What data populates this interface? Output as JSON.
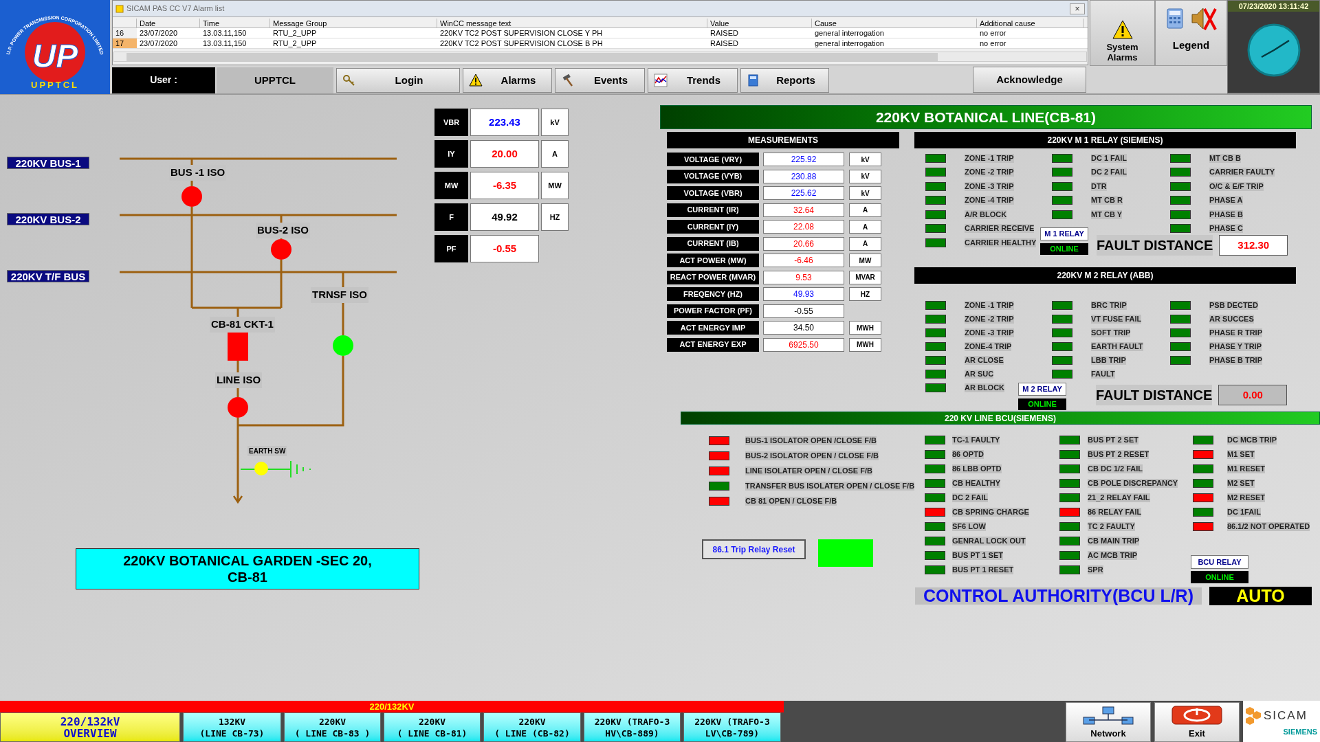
{
  "logo": {
    "arc_text": "U.P. POWER TRANSMISSION CORPORATION LIMITED",
    "mark": "UP",
    "name": "UPPTCL"
  },
  "alarm_window": {
    "title": "SICAM PAS CC V7 Alarm list",
    "close": "×",
    "columns": [
      "",
      "Date",
      "Time",
      "Message Group",
      "WinCC message text",
      "Value",
      "Cause",
      "Additional cause"
    ],
    "rows": [
      {
        "selected": false,
        "cells": [
          "16",
          "23/07/2020",
          "13.03.11,150",
          "RTU_2_UPP",
          "220KV TC2 POST SUPERVISION CLOSE Y PH",
          "RAISED",
          "general interrogation",
          "no error"
        ]
      },
      {
        "selected": true,
        "cells": [
          "17",
          "23/07/2020",
          "13.03.11,150",
          "RTU_2_UPP",
          "220KV TC2 POST SUPERVISION CLOSE B PH",
          "RAISED",
          "general interrogation",
          "no error"
        ]
      }
    ]
  },
  "toolbar": {
    "user_label": "User :",
    "user": "UPPTCL",
    "buttons": [
      {
        "label": "Login"
      },
      {
        "label": "Alarms"
      },
      {
        "label": "Events"
      },
      {
        "label": "Trends"
      },
      {
        "label": "Reports"
      }
    ],
    "acknowledge": "Acknowledge"
  },
  "side_panel": {
    "system_alarms": "System Alarms",
    "legend": "Legend",
    "clock_date": "07/23/2020 13:11:42"
  },
  "diagram": {
    "bus_labels": [
      "220KV BUS-1",
      "220KV BUS-2",
      "220KV T/F BUS"
    ],
    "elements": [
      {
        "kind": "isolator",
        "label": "BUS -1 ISO",
        "color": "#ff0000"
      },
      {
        "kind": "isolator",
        "label": "BUS-2 ISO",
        "color": "#ff0000"
      },
      {
        "kind": "isolator",
        "label": "TRNSF ISO",
        "color": "#00ff00"
      },
      {
        "kind": "breaker",
        "label": "CB-81 CKT-1",
        "color": "#ff0000"
      },
      {
        "kind": "isolator",
        "label": "LINE ISO",
        "color": "#ff0000"
      },
      {
        "kind": "earth_switch",
        "label": "EARTH SW",
        "color": "#ffff00"
      }
    ],
    "location": [
      "220KV BOTANICAL GARDEN -SEC 20,",
      "CB-81"
    ]
  },
  "quick_values": [
    {
      "label": "VBR",
      "value": "223.43",
      "unit": "kV",
      "color": "#0000ff"
    },
    {
      "label": "IY",
      "value": "20.00",
      "unit": "A",
      "color": "#ff0000"
    },
    {
      "label": "MW",
      "value": "-6.35",
      "unit": "MW",
      "color": "#ff0000"
    },
    {
      "label": "F",
      "value": "49.92",
      "unit": "HZ",
      "color": "#000000"
    },
    {
      "label": "PF",
      "value": "-0.55",
      "color": "#ff0000"
    }
  ],
  "line_title": "220KV BOTANICAL LINE(CB-81)",
  "measurements": {
    "title": "MEASUREMENTS",
    "rows": [
      {
        "label": "VOLTAGE (VRY)",
        "value": "225.92",
        "unit": "kV",
        "color": "#0000ff"
      },
      {
        "label": "VOLTAGE (VYB)",
        "value": "230.88",
        "unit": "kV",
        "color": "#0000ff"
      },
      {
        "label": "VOLTAGE (VBR)",
        "value": "225.62",
        "unit": "kV",
        "color": "#0000ff"
      },
      {
        "label": "CURRENT (IR)",
        "value": "32.64",
        "unit": "A",
        "color": "#ff0000"
      },
      {
        "label": "CURRENT (IY)",
        "value": "22.08",
        "unit": "A",
        "color": "#ff0000"
      },
      {
        "label": "CURRENT (IB)",
        "value": "20.66",
        "unit": "A",
        "color": "#ff0000"
      },
      {
        "label": "ACT POWER (MW)",
        "value": "-6.46",
        "unit": "MW",
        "color": "#ff0000"
      },
      {
        "label": "REACT POWER (MVAR)",
        "value": "9.53",
        "unit": "MVAR",
        "color": "#ff0000"
      },
      {
        "label": "FREQENCY (HZ)",
        "value": "49.93",
        "unit": "HZ",
        "color": "#0000ff"
      },
      {
        "label": "POWER FACTOR (PF)",
        "value": "-0.55",
        "color": "#000000"
      },
      {
        "label": "ACT ENERGY IMP",
        "value": "34.50",
        "unit": "MWH",
        "color": "#000000"
      },
      {
        "label": "ACT ENERGY EXP",
        "value": "6925.50",
        "unit": "MWH",
        "color": "#ff0000"
      }
    ]
  },
  "m1_relay": {
    "title": "220KV M 1 RELAY (SIEMENS)",
    "columns": [
      [
        {
          "label": "ZONE -1 TRIP",
          "color": "#008000"
        },
        {
          "label": "ZONE -2 TRIP",
          "color": "#008000"
        },
        {
          "label": "ZONE -3 TRIP",
          "color": "#008000"
        },
        {
          "label": "ZONE -4 TRIP",
          "color": "#008000"
        },
        {
          "label": "A/R BLOCK",
          "color": "#008000"
        },
        {
          "label": "CARRIER RECEIVE",
          "color": "#008000"
        },
        {
          "label": "CARRIER HEALTHY",
          "color": "#008000"
        }
      ],
      [
        {
          "label": "DC 1 FAIL",
          "color": "#008000"
        },
        {
          "label": "DC 2 FAIL",
          "color": "#008000"
        },
        {
          "label": "DTR",
          "color": "#008000"
        },
        {
          "label": "MT CB R",
          "color": "#008000"
        },
        {
          "label": "MT CB Y",
          "color": "#008000"
        }
      ],
      [
        {
          "label": "MT CB B",
          "color": "#008000"
        },
        {
          "label": "CARRIER FAULTY",
          "color": "#008000"
        },
        {
          "label": "O/C & E/F TRIP",
          "color": "#008000"
        },
        {
          "label": "PHASE A",
          "color": "#008000"
        },
        {
          "label": "PHASE B",
          "color": "#008000"
        },
        {
          "label": "PHASE C",
          "color": "#008000"
        }
      ]
    ],
    "relay": "M 1 RELAY",
    "status": "ONLINE",
    "fault_label": "FAULT DISTANCE",
    "fault_value": "312.30"
  },
  "m2_relay": {
    "title": "220KV M 2 RELAY (ABB)",
    "columns": [
      [
        {
          "label": "ZONE -1 TRIP",
          "color": "#008000"
        },
        {
          "label": "ZONE -2 TRIP",
          "color": "#008000"
        },
        {
          "label": "ZONE -3 TRIP",
          "color": "#008000"
        },
        {
          "label": "ZONE-4 TRIP",
          "color": "#008000"
        },
        {
          "label": "AR CLOSE",
          "color": "#008000"
        },
        {
          "label": "AR SUC",
          "color": "#008000"
        },
        {
          "label": "AR BLOCK",
          "color": "#008000"
        }
      ],
      [
        {
          "label": "BRC TRIP",
          "color": "#008000"
        },
        {
          "label": "VT FUSE FAIL",
          "color": "#008000"
        },
        {
          "label": "SOFT TRIP",
          "color": "#008000"
        },
        {
          "label": "EARTH FAULT",
          "color": "#008000"
        },
        {
          "label": "LBB TRIP",
          "color": "#008000"
        },
        {
          "label": "FAULT",
          "color": "#008000"
        }
      ],
      [
        {
          "label": "PSB DECTED",
          "color": "#008000"
        },
        {
          "label": "AR SUCCES",
          "color": "#008000"
        },
        {
          "label": "PHASE R TRIP",
          "color": "#008000"
        },
        {
          "label": "PHASE Y TRIP",
          "color": "#008000"
        },
        {
          "label": "PHASE B TRIP",
          "color": "#008000"
        }
      ]
    ],
    "relay": "M 2 RELAY",
    "status": "ONLINE",
    "fault_label": "FAULT DISTANCE",
    "fault_value": "0.00"
  },
  "bcu": {
    "title": "220 KV LINE BCU(SIEMENS)",
    "columns": [
      [
        {
          "label": "BUS-1 ISOLATOR OPEN /CLOSE  F/B",
          "color": "#ff0000"
        },
        {
          "label": "BUS-2 ISOLATOR OPEN / CLOSE F/B",
          "color": "#ff0000"
        },
        {
          "label": "LINE ISOLATER OPEN / CLOSE F/B",
          "color": "#ff0000"
        },
        {
          "label": "TRANSFER BUS  ISOLATER OPEN / CLOSE  F/B",
          "color": "#008000"
        },
        {
          "label": "CB 81 OPEN / CLOSE F/B",
          "color": "#ff0000"
        }
      ],
      [
        {
          "label": "TC-1 FAULTY",
          "color": "#008000"
        },
        {
          "label": "86 OPTD",
          "color": "#008000"
        },
        {
          "label": "86 LBB OPTD",
          "color": "#008000"
        },
        {
          "label": "CB HEALTHY",
          "color": "#008000"
        },
        {
          "label": "DC 2 FAIL",
          "color": "#008000"
        },
        {
          "label": "CB SPRING CHARGE",
          "color": "#ff0000"
        },
        {
          "label": "SF6 LOW",
          "color": "#008000"
        },
        {
          "label": "GENRAL LOCK OUT",
          "color": "#008000"
        },
        {
          "label": "BUS PT 1 SET",
          "color": "#008000"
        },
        {
          "label": "BUS PT 1 RESET",
          "color": "#008000"
        }
      ],
      [
        {
          "label": "BUS PT 2 SET",
          "color": "#008000"
        },
        {
          "label": "BUS PT 2 RESET",
          "color": "#008000"
        },
        {
          "label": "CB DC 1/2 FAIL",
          "color": "#008000"
        },
        {
          "label": "CB POLE DISCREPANCY",
          "color": "#008000"
        },
        {
          "label": "21_2 RELAY FAIL",
          "color": "#008000"
        },
        {
          "label": "86 RELAY FAIL",
          "color": "#ff0000"
        },
        {
          "label": "TC 2 FAULTY",
          "color": "#008000"
        },
        {
          "label": "CB MAIN TRIP",
          "color": "#008000"
        },
        {
          "label": "AC MCB TRIP",
          "color": "#008000"
        },
        {
          "label": "SPR",
          "color": "#008000"
        }
      ],
      [
        {
          "label": "DC MCB TRIP",
          "color": "#008000"
        },
        {
          "label": "M1 SET",
          "color": "#ff0000"
        },
        {
          "label": "M1 RESET",
          "color": "#008000"
        },
        {
          "label": "M2 SET",
          "color": "#008000"
        },
        {
          "label": "M2 RESET",
          "color": "#ff0000"
        },
        {
          "label": "DC 1FAIL",
          "color": "#008000"
        },
        {
          "label": "86.1/2 NOT OPERATED",
          "color": "#ff0000"
        }
      ]
    ],
    "reset_button": "86.1 Trip Relay Reset",
    "relay": "BCU RELAY",
    "status": "ONLINE",
    "authority_label": "CONTROL AUTHORITY(BCU L/R)",
    "authority_value": "AUTO"
  },
  "bottom_nav": {
    "group": "220/132KV",
    "buttons": [
      {
        "lines": [
          "220/132kV",
          "OVERVIEW"
        ],
        "selected": true
      },
      {
        "lines": [
          "132KV",
          "(LINE  CB-73)"
        ],
        "selected": false
      },
      {
        "lines": [
          "220KV",
          "( LINE CB-83 )"
        ],
        "selected": false
      },
      {
        "lines": [
          "220KV",
          "( LINE  CB-81)"
        ],
        "selected": false
      },
      {
        "lines": [
          "220KV",
          "( LINE  (CB-82)"
        ],
        "selected": false
      },
      {
        "lines": [
          "220KV (TRAFO-3",
          "HV\\CB-889)"
        ],
        "selected": false
      },
      {
        "lines": [
          "220KV (TRAFO-3",
          "LV\\CB-789)"
        ],
        "selected": false
      }
    ],
    "network": "Network",
    "exit": "Exit",
    "brand": "SICAM",
    "maker": "SIEMENS"
  }
}
